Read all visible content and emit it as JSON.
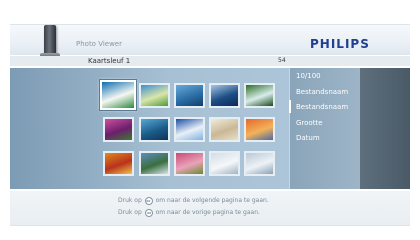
{
  "header": {
    "app_title": "Photo Viewer",
    "logo": "PHILIPS"
  },
  "titlebar": {
    "breadcrumb": "Kaartsleuf 1",
    "count": "54"
  },
  "thumbnails": [
    {
      "name": "tropical-beach",
      "colors": [
        "#0e6db0",
        "#f5f7f2",
        "#2b8a3c"
      ],
      "selected": true
    },
    {
      "name": "tropical-island",
      "colors": [
        "#3d8ed0",
        "#d9e6a8",
        "#4c9a3a"
      ]
    },
    {
      "name": "ocean-swimmer",
      "colors": [
        "#6aa9d9",
        "#2b6fa6",
        "#113e6b"
      ]
    },
    {
      "name": "sea-mountains",
      "colors": [
        "#a8c7e4",
        "#1d4e86",
        "#0c2a55"
      ]
    },
    {
      "name": "waterfall-forest",
      "colors": [
        "#2f6e2a",
        "#d8ecea",
        "#1a4a1d"
      ]
    },
    {
      "name": "purple-flowers",
      "colors": [
        "#d04fa0",
        "#6b1f6d",
        "#3b7a2f"
      ]
    },
    {
      "name": "diver-underwater",
      "colors": [
        "#58a8d4",
        "#1c5c8a",
        "#0e3357"
      ]
    },
    {
      "name": "blue-dome-church",
      "colors": [
        "#1b4ea5",
        "#e9f0f7",
        "#7fb0e2"
      ]
    },
    {
      "name": "shell-white",
      "colors": [
        "#f1ecd9",
        "#c9b896",
        "#e8e0c8"
      ]
    },
    {
      "name": "sunset-sea",
      "colors": [
        "#e36a2c",
        "#f3b25a",
        "#4a6aa4"
      ]
    },
    {
      "name": "autumn-leaves",
      "colors": [
        "#e08a1e",
        "#b8321c",
        "#f2c24a"
      ]
    },
    {
      "name": "mountain-lake",
      "colors": [
        "#5f8cc0",
        "#3a6f3d",
        "#d6e4ef"
      ]
    },
    {
      "name": "pink-flowers",
      "colors": [
        "#c94a78",
        "#e9a3b9",
        "#6b8a2d"
      ]
    },
    {
      "name": "white-bears",
      "colors": [
        "#d2dde6",
        "#f5f7f8",
        "#9fb3c4"
      ]
    },
    {
      "name": "snowy-landscape",
      "colors": [
        "#b9c9d6",
        "#edf2f6",
        "#8aa1b4"
      ]
    }
  ],
  "menu": {
    "items": [
      "10/100",
      "Bestandsnaam",
      "Bestandsnaam",
      "Grootte",
      "Datum"
    ],
    "active_index": 2
  },
  "hints": {
    "next": {
      "prefix": "Druk op",
      "button": "▸▸",
      "suffix": "om naar de volgende pagina te gaan."
    },
    "prev": {
      "prefix": "Druk op",
      "button": "◂◂",
      "suffix": "om naar de vorige pagina te gaan."
    }
  },
  "colors": {
    "accent": "#1f3f93",
    "panel": "#a7c0d3",
    "menu_text": "#ffffff"
  }
}
